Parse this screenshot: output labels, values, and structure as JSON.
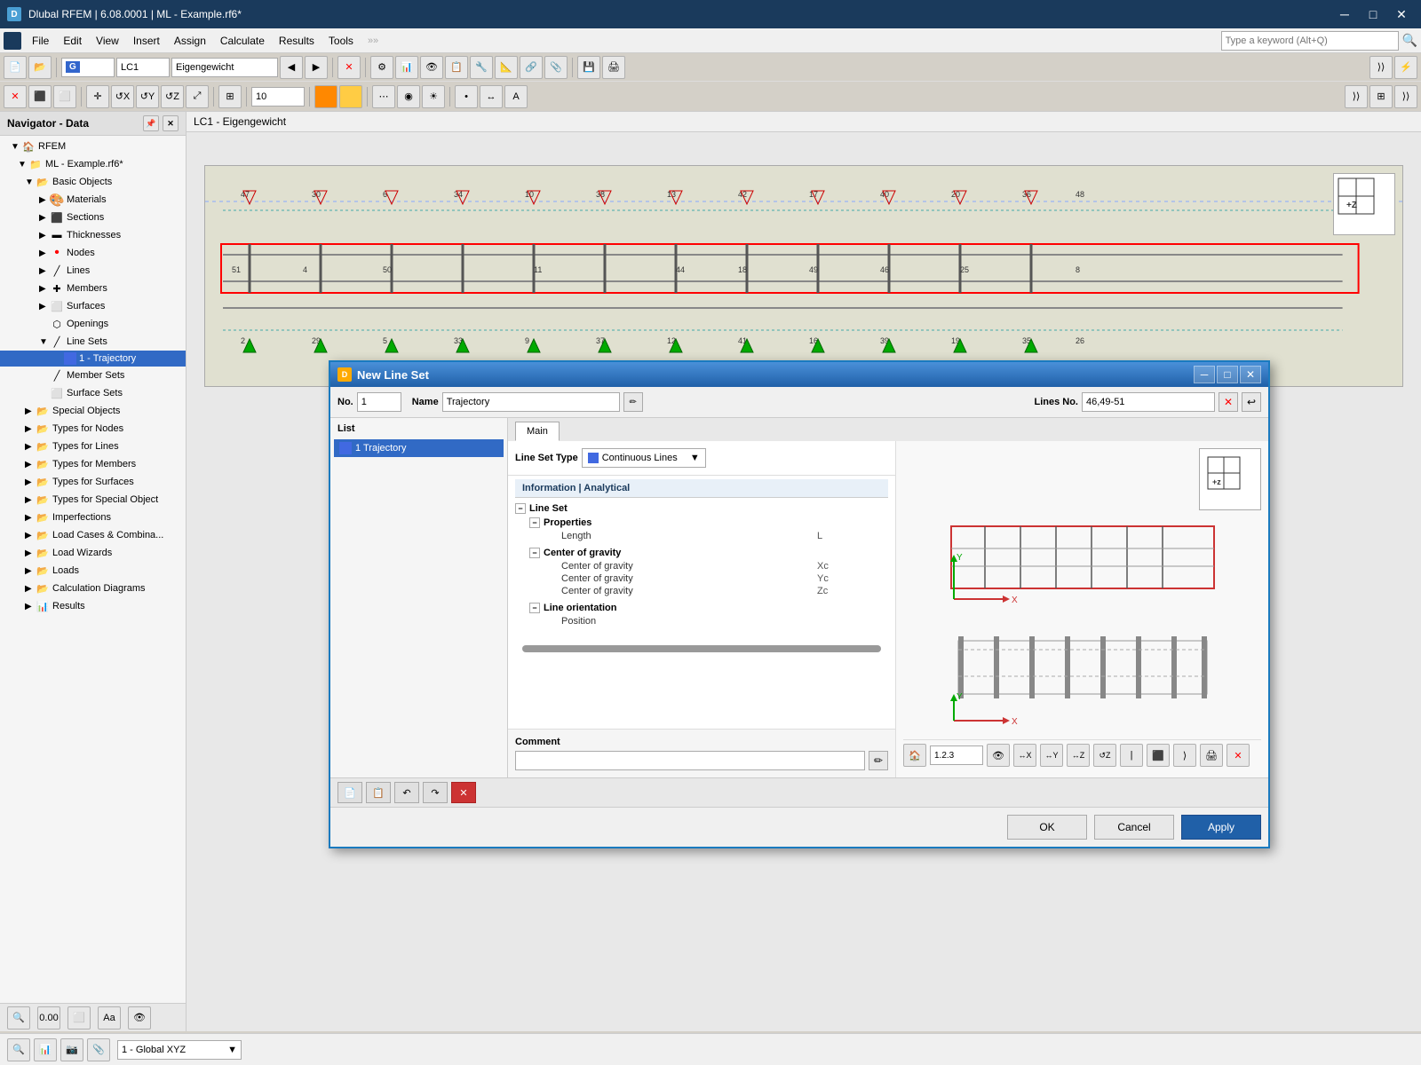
{
  "app": {
    "title": "Dlubal RFEM | 6.08.0001 | ML - Example.rf6*",
    "icon": "D"
  },
  "menubar": {
    "items": [
      "File",
      "Edit",
      "View",
      "Insert",
      "Assign",
      "Calculate",
      "Results",
      "Tools"
    ]
  },
  "toolbar": {
    "lc_label": "G",
    "lc_number": "LC1",
    "lc_name": "Eigengewicht"
  },
  "navigator": {
    "title": "Navigator - Data",
    "root": "RFEM",
    "file": "ML - Example.rf6*",
    "items": [
      {
        "label": "Basic Objects",
        "indent": 2,
        "type": "folder",
        "expanded": true
      },
      {
        "label": "Materials",
        "indent": 3,
        "type": "material"
      },
      {
        "label": "Sections",
        "indent": 3,
        "type": "section"
      },
      {
        "label": "Thicknesses",
        "indent": 3,
        "type": "thickness"
      },
      {
        "label": "Nodes",
        "indent": 3,
        "type": "node"
      },
      {
        "label": "Lines",
        "indent": 3,
        "type": "line"
      },
      {
        "label": "Members",
        "indent": 3,
        "type": "member"
      },
      {
        "label": "Surfaces",
        "indent": 3,
        "type": "surface"
      },
      {
        "label": "Openings",
        "indent": 3,
        "type": "opening"
      },
      {
        "label": "Line Sets",
        "indent": 3,
        "type": "lineset",
        "expanded": true
      },
      {
        "label": "1 - Trajectory",
        "indent": 4,
        "type": "trajectory",
        "selected": true
      },
      {
        "label": "Member Sets",
        "indent": 3,
        "type": "memberset"
      },
      {
        "label": "Surface Sets",
        "indent": 3,
        "type": "surfaceset"
      },
      {
        "label": "Special Objects",
        "indent": 2,
        "type": "folder"
      },
      {
        "label": "Types for Nodes",
        "indent": 2,
        "type": "folder"
      },
      {
        "label": "Types for Lines",
        "indent": 2,
        "type": "folder"
      },
      {
        "label": "Types for Members",
        "indent": 2,
        "type": "folder"
      },
      {
        "label": "Types for Surfaces",
        "indent": 2,
        "type": "folder"
      },
      {
        "label": "Types for Special Object",
        "indent": 2,
        "type": "folder"
      },
      {
        "label": "Imperfections",
        "indent": 2,
        "type": "folder"
      },
      {
        "label": "Load Cases & Combina...",
        "indent": 2,
        "type": "folder"
      },
      {
        "label": "Load Wizards",
        "indent": 2,
        "type": "folder"
      },
      {
        "label": "Loads",
        "indent": 2,
        "type": "folder"
      },
      {
        "label": "Calculation Diagrams",
        "indent": 2,
        "type": "folder"
      },
      {
        "label": "Results",
        "indent": 2,
        "type": "folder"
      }
    ]
  },
  "canvas": {
    "title": "LC1 - Eigengewicht"
  },
  "dialog": {
    "title": "New Line Set",
    "no_label": "No.",
    "no_value": "1",
    "name_label": "Name",
    "name_value": "Trajectory",
    "lines_no_label": "Lines No.",
    "lines_no_value": "46,49-51",
    "list_header": "List",
    "list_item": "1 Trajectory",
    "tab_main": "Main",
    "line_set_type_label": "Line Set Type",
    "line_set_type_value": "Continuous Lines",
    "info_header": "Information | Analytical",
    "sections": [
      {
        "label": "Line Set",
        "children": [
          {
            "label": "Properties",
            "children": [
              {
                "key": "Length",
                "val": "L"
              }
            ]
          },
          {
            "label": "Center of gravity",
            "children": [
              {
                "key": "Center of gravity",
                "val": "Xc"
              },
              {
                "key": "Center of gravity",
                "val": "Yc"
              },
              {
                "key": "Center of gravity",
                "val": "Zc"
              }
            ]
          },
          {
            "label": "Line orientation",
            "children": [
              {
                "key": "Position",
                "val": ""
              }
            ]
          }
        ]
      }
    ],
    "comment_label": "Comment",
    "comment_placeholder": "",
    "buttons": {
      "ok": "OK",
      "cancel": "Cancel",
      "apply": "Apply"
    }
  },
  "bottom_bar": {
    "coordinate_system": "1 - Global XYZ"
  }
}
